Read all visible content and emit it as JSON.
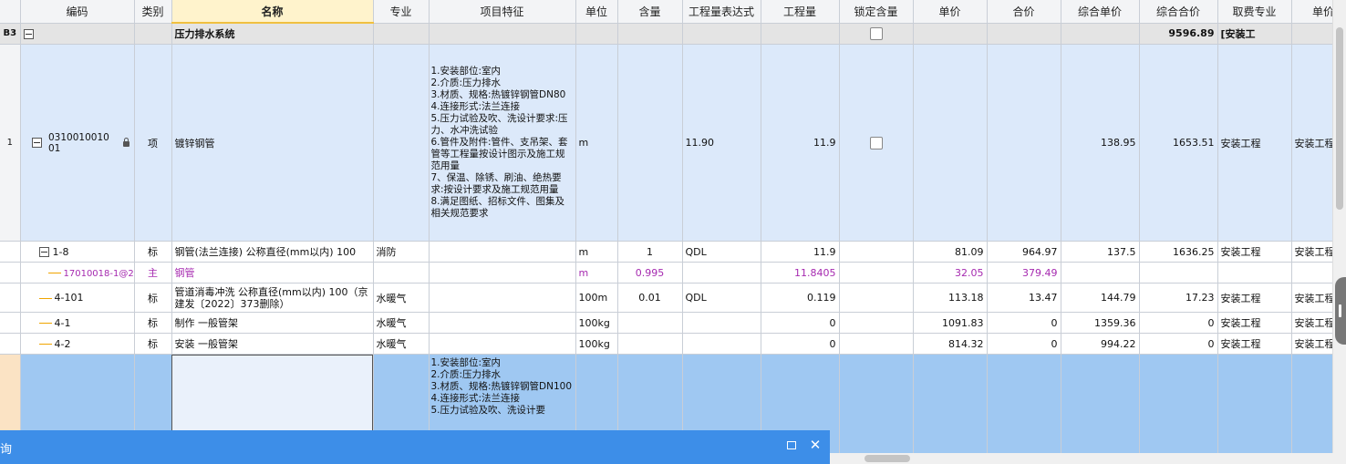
{
  "columns": [
    "编码",
    "类别",
    "名称",
    "专业",
    "项目特征",
    "单位",
    "含量",
    "工程量表达式",
    "工程量",
    "锁定含量",
    "单价",
    "合价",
    "综合单价",
    "综合合价",
    "取费专业",
    "单价构"
  ],
  "group": {
    "rowno": "B3",
    "name": "压力排水系统",
    "total": "9596.89",
    "fee": "[安装工"
  },
  "item1": {
    "rowno": "1",
    "code": "031001001001",
    "type": "项",
    "name": "镀锌钢管",
    "features": [
      "1.安装部位:室内",
      "2.介质:压力排水",
      "3.材质、规格:热镀锌钢管DN80",
      "4.连接形式:法兰连接",
      "5.压力试验及吹、洗设计要求:压力、水冲洗试验",
      "6.管件及附件:管件、支吊架、套管等工程量按设计图示及施工规范用量",
      "7、保温、除锈、刷油、绝热要求:按设计要求及施工规范用量",
      "8.满足图纸、招标文件、图集及相关规范要求"
    ],
    "unit": "m",
    "expr": "11.90",
    "qty": "11.9",
    "combo_price": "138.95",
    "combo_total": "1653.51",
    "fee": "安装工程",
    "price_comp": "安装工程"
  },
  "subs": [
    {
      "code": "1-8",
      "type": "标",
      "name": "钢管(法兰连接) 公称直径(mm以内) 100",
      "spec": "消防",
      "unit": "m",
      "content": "1",
      "expr": "QDL",
      "qty": "11.9",
      "price": "81.09",
      "total": "964.97",
      "combo_price": "137.5",
      "combo_total": "1636.25",
      "fee": "安装工程",
      "price_comp": "安装工程"
    },
    {
      "code": "17010018-1@2",
      "type": "主",
      "name": "钢管",
      "spec": "",
      "unit": "m",
      "content": "0.995",
      "expr": "",
      "qty": "11.8405",
      "price": "32.05",
      "total": "379.49",
      "combo_price": "",
      "combo_total": "",
      "fee": "",
      "price_comp": ""
    },
    {
      "code": "4-101",
      "type": "标",
      "name": "管道消毒冲洗 公称直径(mm以内) 100（京建发〔2022〕373删除）",
      "spec": "水暖气",
      "unit": "100m",
      "content": "0.01",
      "expr": "QDL",
      "qty": "0.119",
      "price": "113.18",
      "total": "13.47",
      "combo_price": "144.79",
      "combo_total": "17.23",
      "fee": "安装工程",
      "price_comp": "安装工程"
    },
    {
      "code": "4-1",
      "type": "标",
      "name": "制作 一般管架",
      "spec": "水暖气",
      "unit": "100kg",
      "content": "",
      "expr": "",
      "qty": "0",
      "price": "1091.83",
      "total": "0",
      "combo_price": "1359.36",
      "combo_total": "0",
      "fee": "安装工程",
      "price_comp": "安装工程"
    },
    {
      "code": "4-2",
      "type": "标",
      "name": "安装 一般管架",
      "spec": "水暖气",
      "unit": "100kg",
      "content": "",
      "expr": "",
      "qty": "0",
      "price": "814.32",
      "total": "0",
      "combo_price": "994.22",
      "combo_total": "0",
      "fee": "安装工程",
      "price_comp": "安装工程"
    }
  ],
  "item2": {
    "features": [
      "1.安装部位:室内",
      "2.介质:压力排水",
      "3.材质、规格:热镀锌钢管DN100",
      "4.连接形式:法兰连接",
      "5.压力试验及吹、洗设计要"
    ]
  },
  "panel": {
    "title": "询"
  }
}
